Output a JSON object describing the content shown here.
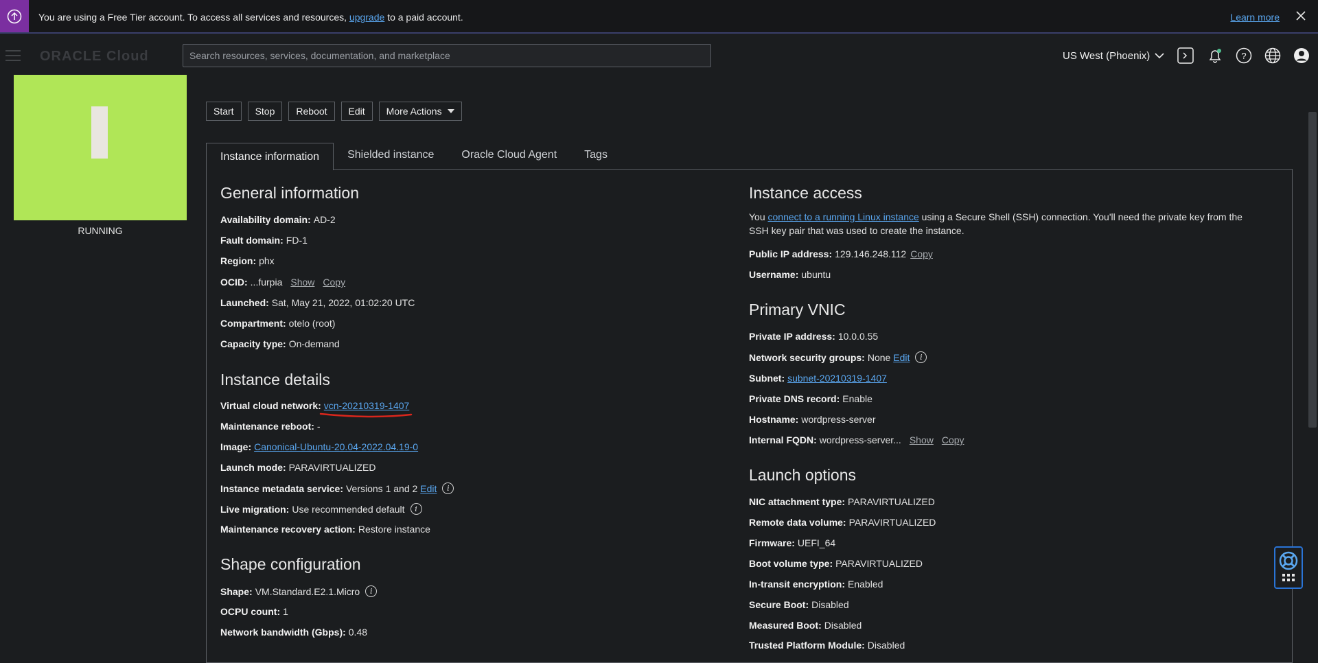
{
  "banner": {
    "text_before": "You are using a Free Tier account. To access all services and resources,",
    "link": "upgrade",
    "text_after": "to a paid account.",
    "learn_more": "Learn more"
  },
  "header": {
    "logo": "ORACLE Cloud",
    "search_placeholder": "Search resources, services, documentation, and marketplace",
    "region": "US West (Phoenix)"
  },
  "instance": {
    "status": "RUNNING"
  },
  "actions": [
    "Start",
    "Stop",
    "Reboot",
    "Edit",
    "More Actions"
  ],
  "tabs": [
    "Instance information",
    "Shielded instance",
    "Oracle Cloud Agent",
    "Tags"
  ],
  "general": {
    "title": "General information",
    "availability_domain": {
      "label": "Availability domain:",
      "value": "AD-2"
    },
    "fault_domain": {
      "label": "Fault domain:",
      "value": "FD-1"
    },
    "region": {
      "label": "Region:",
      "value": "phx"
    },
    "ocid": {
      "label": "OCID:",
      "value": "...furpia",
      "show": "Show",
      "copy": "Copy"
    },
    "launched": {
      "label": "Launched:",
      "value": "Sat, May 21, 2022, 01:02:20 UTC"
    },
    "compartment": {
      "label": "Compartment:",
      "value": "otelo (root)"
    },
    "capacity": {
      "label": "Capacity type:",
      "value": "On-demand"
    }
  },
  "details": {
    "title": "Instance details",
    "vcn": {
      "label": "Virtual cloud network:",
      "value": "vcn-20210319-1407"
    },
    "maint_reboot": {
      "label": "Maintenance reboot:",
      "value": "-"
    },
    "image": {
      "label": "Image:",
      "value": "Canonical-Ubuntu-20.04-2022.04.19-0"
    },
    "launch_mode": {
      "label": "Launch mode:",
      "value": "PARAVIRTUALIZED"
    },
    "metadata": {
      "label": "Instance metadata service:",
      "value": "Versions 1 and 2",
      "edit": "Edit"
    },
    "live_migration": {
      "label": "Live migration:",
      "value": "Use recommended default"
    },
    "maint_recovery": {
      "label": "Maintenance recovery action:",
      "value": "Restore instance"
    }
  },
  "shape": {
    "title": "Shape configuration",
    "shape": {
      "label": "Shape:",
      "value": "VM.Standard.E2.1.Micro"
    },
    "ocpu": {
      "label": "OCPU count:",
      "value": "1"
    },
    "bandwidth": {
      "label": "Network bandwidth (Gbps):",
      "value": "0.48"
    }
  },
  "access": {
    "title": "Instance access",
    "para_before": "You",
    "para_link": "connect to a running Linux instance",
    "para_after": "using a Secure Shell (SSH) connection. You'll need the private key from the SSH key pair that was used to create the instance.",
    "public_ip": {
      "label": "Public IP address:",
      "value": "129.146.248.112",
      "copy": "Copy"
    },
    "username": {
      "label": "Username:",
      "value": "ubuntu"
    }
  },
  "vnic": {
    "title": "Primary VNIC",
    "private_ip": {
      "label": "Private IP address:",
      "value": "10.0.0.55"
    },
    "nsg": {
      "label": "Network security groups:",
      "value": "None",
      "edit": "Edit"
    },
    "subnet": {
      "label": "Subnet:",
      "value": "subnet-20210319-1407"
    },
    "dns": {
      "label": "Private DNS record:",
      "value": "Enable"
    },
    "hostname": {
      "label": "Hostname:",
      "value": "wordpress-server"
    },
    "fqdn": {
      "label": "Internal FQDN:",
      "value": "wordpress-server...",
      "show": "Show",
      "copy": "Copy"
    }
  },
  "launch": {
    "title": "Launch options",
    "nic": {
      "label": "NIC attachment type:",
      "value": "PARAVIRTUALIZED"
    },
    "remote": {
      "label": "Remote data volume:",
      "value": "PARAVIRTUALIZED"
    },
    "firmware": {
      "label": "Firmware:",
      "value": "UEFI_64"
    },
    "boot": {
      "label": "Boot volume type:",
      "value": "PARAVIRTUALIZED"
    },
    "transit": {
      "label": "In-transit encryption:",
      "value": "Enabled"
    },
    "secure_boot": {
      "label": "Secure Boot:",
      "value": "Disabled"
    },
    "measured": {
      "label": "Measured Boot:",
      "value": "Disabled"
    },
    "tpm": {
      "label": "Trusted Platform Module:",
      "value": "Disabled"
    }
  },
  "colors": {
    "banner_icon": "#7b2fa0",
    "tile": "#b0e657",
    "link": "#5aa7f0",
    "annotation": "#d9261c"
  }
}
